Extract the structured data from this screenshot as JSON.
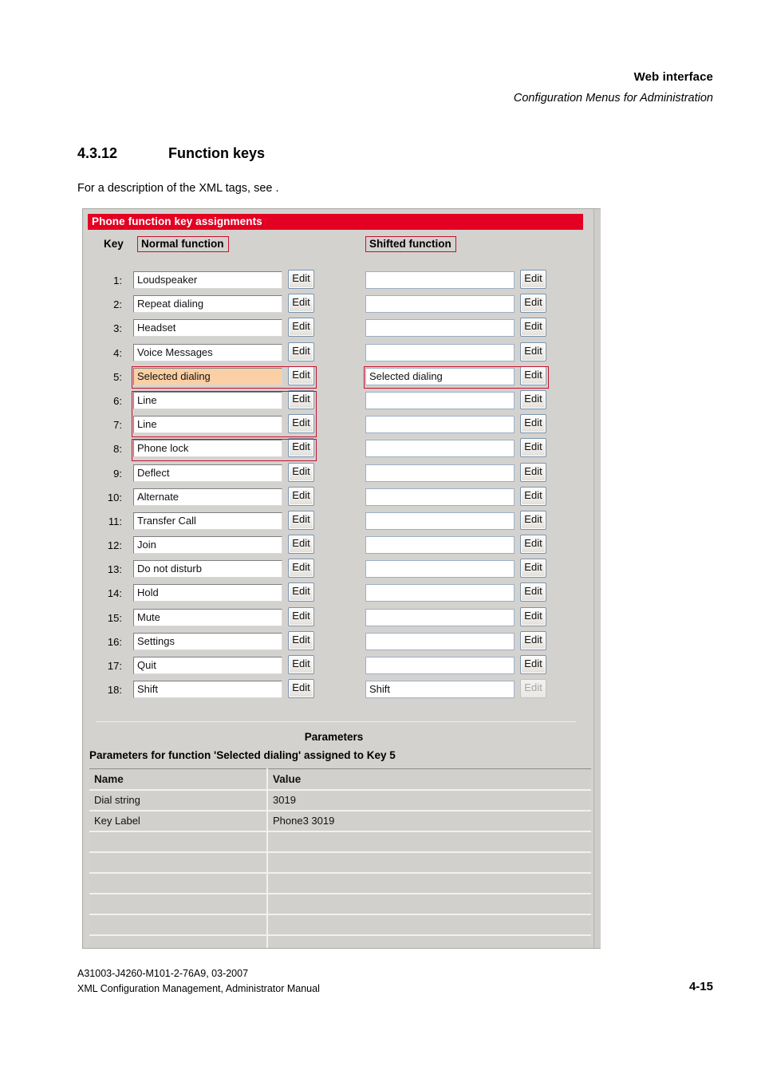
{
  "page_header": {
    "title": "Web interface",
    "subtitle": "Configuration Menus for Administration"
  },
  "section": {
    "number": "4.3.12",
    "title": "Function keys",
    "intro": "For a description of the XML tags, see ."
  },
  "screenshot": {
    "window_title": "Phone function key assignments",
    "columns": {
      "key": "Key",
      "normal": "Normal function",
      "shifted": "Shifted function"
    },
    "edit_label": "Edit",
    "rows": [
      {
        "num": "1:",
        "normal": "Loudspeaker",
        "shifted": ""
      },
      {
        "num": "2:",
        "normal": "Repeat dialing",
        "shifted": ""
      },
      {
        "num": "3:",
        "normal": "Headset",
        "shifted": ""
      },
      {
        "num": "4:",
        "normal": "Voice Messages",
        "shifted": ""
      },
      {
        "num": "5:",
        "normal": "Selected dialing",
        "shifted": "Selected dialing"
      },
      {
        "num": "6:",
        "normal": "Line",
        "shifted": ""
      },
      {
        "num": "7:",
        "normal": "Line",
        "shifted": ""
      },
      {
        "num": "8:",
        "normal": "Phone lock",
        "shifted": ""
      },
      {
        "num": "9:",
        "normal": "Deflect",
        "shifted": ""
      },
      {
        "num": "10:",
        "normal": "Alternate",
        "shifted": ""
      },
      {
        "num": "11:",
        "normal": "Transfer Call",
        "shifted": ""
      },
      {
        "num": "12:",
        "normal": "Join",
        "shifted": ""
      },
      {
        "num": "13:",
        "normal": "Do not disturb",
        "shifted": ""
      },
      {
        "num": "14:",
        "normal": "Hold",
        "shifted": ""
      },
      {
        "num": "15:",
        "normal": "Mute",
        "shifted": ""
      },
      {
        "num": "16:",
        "normal": "Settings",
        "shifted": ""
      },
      {
        "num": "17:",
        "normal": "Quit",
        "shifted": ""
      },
      {
        "num": "18:",
        "normal": "Shift",
        "shifted": "Shift"
      }
    ],
    "parameters": {
      "heading": "Parameters",
      "subheading": "Parameters for function 'Selected dialing' assigned to Key 5",
      "col_name": "Name",
      "col_value": "Value",
      "rows": [
        {
          "name": "Dial string",
          "value": "3019"
        },
        {
          "name": "Key Label",
          "value": "Phone3 3019"
        },
        {
          "name": "",
          "value": ""
        },
        {
          "name": "",
          "value": ""
        },
        {
          "name": "",
          "value": ""
        },
        {
          "name": "",
          "value": ""
        },
        {
          "name": "",
          "value": ""
        },
        {
          "name": "",
          "value": ""
        }
      ]
    },
    "colors": {
      "title_bar": "#e30022",
      "annotation": "#c8102e",
      "highlight_row": "#fbcfa4",
      "panel_bg": "#d2d0cd"
    }
  },
  "footer": {
    "doc_id": "A31003-J4260-M101-2-76A9, 03-2007",
    "manual": "XML Configuration Management, Administrator Manual",
    "page": "4-15"
  }
}
